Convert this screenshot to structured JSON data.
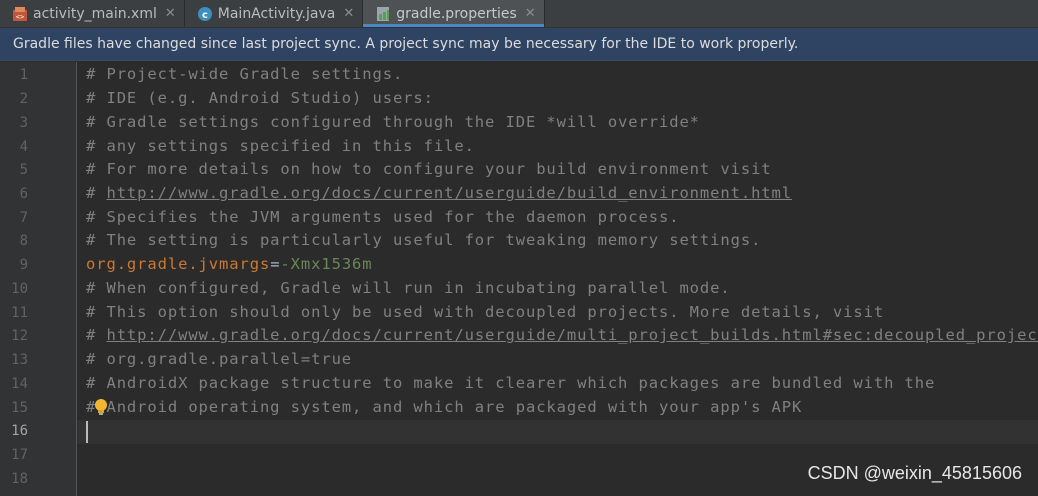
{
  "tabs": [
    {
      "label": "activity_main.xml",
      "icon": "xml-file-icon",
      "active": false
    },
    {
      "label": "MainActivity.java",
      "icon": "java-class-icon",
      "active": false
    },
    {
      "label": "gradle.properties",
      "icon": "gradle-file-icon",
      "active": true
    }
  ],
  "banner": {
    "message": "Gradle files have changed since last project sync. A project sync may be necessary for the IDE to work properly."
  },
  "gutter": {
    "line_numbers": [
      "1",
      "2",
      "3",
      "4",
      "5",
      "6",
      "7",
      "8",
      "9",
      "10",
      "11",
      "12",
      "13",
      "14",
      "15",
      "16",
      "17",
      "18"
    ],
    "current_line": "16"
  },
  "code": {
    "line1": "# Project-wide Gradle settings.",
    "line2": "# IDE (e.g. Android Studio) users:",
    "line3": "# Gradle settings configured through the IDE *will override*",
    "line4": "# any settings specified in this file.",
    "line5": "# For more details on how to configure your build environment visit",
    "line6_prefix": "# ",
    "line6_link": "http://www.gradle.org/docs/current/userguide/build_environment.html",
    "line7": "# Specifies the JVM arguments used for the daemon process.",
    "line8": "# The setting is particularly useful for tweaking memory settings.",
    "line9_key": "org.gradle.jvmargs",
    "line9_eq": "=",
    "line9_value": "-Xmx1536m",
    "line10": "# When configured, Gradle will run in incubating parallel mode.",
    "line11": "# This option should only be used with decoupled projects. More details, visit",
    "line12_prefix": "# ",
    "line12_link": "http://www.gradle.org/docs/current/userguide/multi_project_builds.html#sec:decoupled_projects",
    "line13": "# org.gradle.parallel=true",
    "line14": "# AndroidX package structure to make it clearer which packages are bundled with the",
    "line15": "# Android operating system, and which are packaged with your app's APK",
    "line16": "",
    "line17": "",
    "line18": ""
  },
  "watermark": "CSDN @weixin_45815606",
  "colors": {
    "editor_bg": "#2b2b2b",
    "comment": "#808080",
    "property_key": "#cc7832",
    "property_value": "#6a8759",
    "banner_bg": "#2f4363",
    "active_tab_underline": "#4a88c7"
  }
}
